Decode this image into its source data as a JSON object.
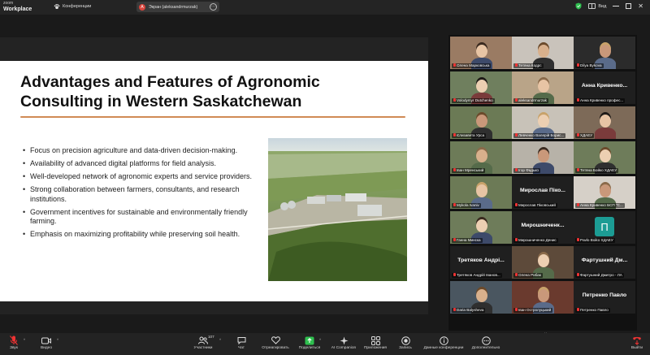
{
  "app": {
    "brand_line1": "zoom",
    "brand_line2": "Workplace",
    "conference_label": "Конференции"
  },
  "screen_share": {
    "badge_letter": "A",
    "label": "Экран (aleksandrmurzak)"
  },
  "topbar": {
    "view_label": "Вид"
  },
  "slide": {
    "title_line1": "Advantages and Features of Agronomic",
    "title_line2": "Consulting in Western Saskatchewan",
    "bullets": [
      "Focus on precision agriculture and data-driven decision-making.",
      "Availability of advanced digital platforms for field analysis.",
      "Well-developed network of agronomic experts and service providers.",
      "Strong collaboration between farmers, consultants, and research institutions.",
      "Government incentives for sustainable and environmentally friendly farming.",
      "Emphasis on maximizing profitability while preserving soil health."
    ]
  },
  "gallery": {
    "tiles": [
      {
        "name": "Олена Марковська",
        "big": "",
        "kind": "video",
        "bg": "#9a7b63"
      },
      {
        "name": "Тетяна Кодрс",
        "big": "",
        "kind": "video",
        "bg": "#c9c3bb"
      },
      {
        "name": "Dilya Bykova",
        "big": "",
        "kind": "video",
        "bg": "#2b2b2b"
      },
      {
        "name": "Volodymyr Dutchenko",
        "big": "",
        "kind": "video",
        "bg": "#6f7f5e"
      },
      {
        "name": "aleksandrmurzak",
        "big": "",
        "kind": "video",
        "bg": "#b9a488"
      },
      {
        "name": "Анна Кривенко профес...",
        "big": "Анна Кривенко...",
        "kind": "text",
        "bg": "#1f1f1f"
      },
      {
        "name": "Єлизавета Урса",
        "big": "",
        "kind": "video",
        "bg": "#6b7a55"
      },
      {
        "name": "Левченко Валерій Борис...",
        "big": "",
        "kind": "video",
        "bg": "#c8c2b8"
      },
      {
        "name": "ХДАЕУ",
        "big": "",
        "kind": "video",
        "bg": "#7d6a58"
      },
      {
        "name": "Іван Мренський",
        "big": "",
        "kind": "video",
        "bg": "#6d7b58"
      },
      {
        "name": "Ігор Фадько",
        "big": "",
        "kind": "video",
        "bg": "#b7b2a8"
      },
      {
        "name": "Тетяна Бойко ХДАЕУ",
        "big": "",
        "kind": "video",
        "bg": "#6e7c5a"
      },
      {
        "name": "Mykola Ivaniv",
        "big": "",
        "kind": "video",
        "bg": "#6c7a56"
      },
      {
        "name": "Мирослав Піковський",
        "big": "Мирослав Піко...",
        "kind": "text",
        "bg": "#1f1f1f"
      },
      {
        "name": "Анна Кривенко БСП \"С...",
        "big": "",
        "kind": "video",
        "bg": "#d6d0c8"
      },
      {
        "name": "Ганна Минска",
        "big": "",
        "kind": "video",
        "bg": "#6e7c5a"
      },
      {
        "name": "Мирошниченко Денис",
        "big": "Мирошниченк...",
        "kind": "text",
        "bg": "#1f1f1f"
      },
      {
        "name": "Pavlo Boiko ХДАЕУ",
        "big": "П",
        "kind": "letter",
        "bg": "#1c9c94"
      },
      {
        "name": "Третяков Андрій Іванов...",
        "big": "Третяков Андрі...",
        "kind": "text",
        "bg": "#1f1f1f"
      },
      {
        "name": "Олена Рибак",
        "big": "",
        "kind": "video",
        "bg": "#5d4a3a"
      },
      {
        "name": "Фартушний Дмитро - ЛА",
        "big": "Фартушний Дм...",
        "kind": "text",
        "bg": "#1f1f1f"
      },
      {
        "name": "Daria Balysheva",
        "big": "",
        "kind": "video",
        "bg": "#4a5660"
      },
      {
        "name": "Іван Остролуцький",
        "big": "",
        "kind": "video",
        "bg": "#6a3a2e"
      },
      {
        "name": "Петренко Павло",
        "big": "Петренко Павло",
        "kind": "text",
        "bg": "#1f1f1f"
      }
    ]
  },
  "toolbar": {
    "audio_label": "Звук",
    "video_label": "Видео",
    "participants_count": "107",
    "participants_label": "Участники",
    "chat_label": "Чат",
    "react_label": "Отреагировать",
    "share_label": "Поделиться",
    "ai_label": "AI Companion",
    "apps_label": "Приложения",
    "record_label": "Запись",
    "info_label": "Данные конференции",
    "more_label": "Дополнительно",
    "leave_label": "Выйти"
  },
  "colors": {
    "accent_green": "#2fbf4f",
    "slide_underline": "#d08a55",
    "mic_muted": "#e33333"
  }
}
